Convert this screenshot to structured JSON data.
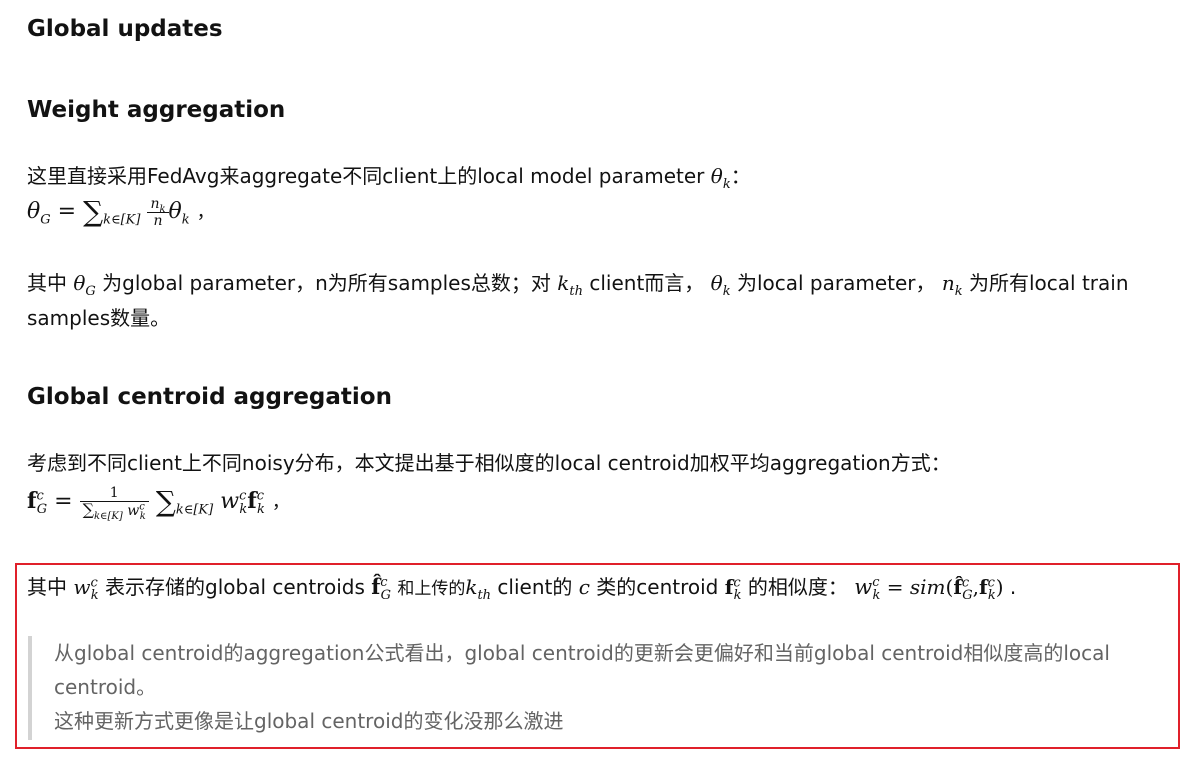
{
  "headings": {
    "global_updates": "Global updates",
    "weight_aggregation": "Weight aggregation",
    "global_centroid_aggregation": "Global centroid aggregation"
  },
  "weight": {
    "intro_text": "这里直接采用FedAvg来aggregate不同client上的local model parameter",
    "intro_math": "θ",
    "intro_math_sub": "k",
    "intro_end": "：",
    "formula_lhs": "θ",
    "formula_lhs_sub": "G",
    "formula_eq": "=",
    "formula_sum": "∑",
    "formula_sum_sub": "k∈[K]",
    "formula_frac_num": "n",
    "formula_frac_num_sub": "k",
    "formula_frac_den": "n",
    "formula_theta": "θ",
    "formula_theta_sub": "k",
    "formula_end": "，",
    "desc_1": "其中",
    "desc_theta_g": "θ",
    "desc_theta_g_sub": "G",
    "desc_2": "为global parameter，n为所有samples总数；对",
    "desc_k": "k",
    "desc_k_sub": "th",
    "desc_3": "client而言，",
    "desc_theta_k": "θ",
    "desc_theta_k_sub": "k",
    "desc_4": "为local parameter，",
    "desc_n": "n",
    "desc_n_sub": "k",
    "desc_5": "为所有local train",
    "desc_line2": "samples数量。"
  },
  "centroid": {
    "intro_text": "考虑到不同client上不同noisy分布，本文提出基于相似度的local centroid加权平均aggregation方式：",
    "formula_f": "f",
    "formula_f_sup": "c",
    "formula_f_sub": "G",
    "formula_eq": "=",
    "formula_frac_num": "1",
    "formula_frac_den_sum": "∑",
    "formula_frac_den_sub": "k∈[K]",
    "formula_frac_den_w": "w",
    "formula_frac_den_w_sup": "c",
    "formula_frac_den_w_sub": "k",
    "formula_sum": "∑",
    "formula_sum_sub": "k∈[K]",
    "formula_w": "w",
    "formula_w_sup": "c",
    "formula_w_sub": "k",
    "formula_fk": "f",
    "formula_fk_sup": "c",
    "formula_fk_sub": "k",
    "formula_end": "，"
  },
  "highlight": {
    "p1": "其中",
    "w": "w",
    "w_sup": "c",
    "w_sub": "k",
    "p2": "表示存储的global centroids",
    "fhat": "f̂",
    "fhat_sup": "c",
    "fhat_sub": "G",
    "p3": "和上传的",
    "k": "k",
    "k_sub": "th",
    "p4": "client的",
    "c": "c",
    "p5": "类的centroid",
    "fk": "f",
    "fk_sup": "c",
    "fk_sub": "k",
    "p6": "的相似度：",
    "eq_w": "w",
    "eq_w_sup": "c",
    "eq_w_sub": "k",
    "eq": "=",
    "sim": "sim",
    "open": "(",
    "eq_fhat": "f̂",
    "eq_fhat_sup": "c",
    "eq_fhat_sub": "G",
    "comma": ",",
    "eq_fk": "f",
    "eq_fk_sup": "c",
    "eq_fk_sub": "k",
    "close": ")",
    "end": "."
  },
  "quote": {
    "line1": "从global centroid的aggregation公式看出，global centroid的更新会更偏好和当前global centroid相似度高的local",
    "line2": "centroid。",
    "line3": "这种更新方式更像是让global centroid的变化没那么激进"
  }
}
